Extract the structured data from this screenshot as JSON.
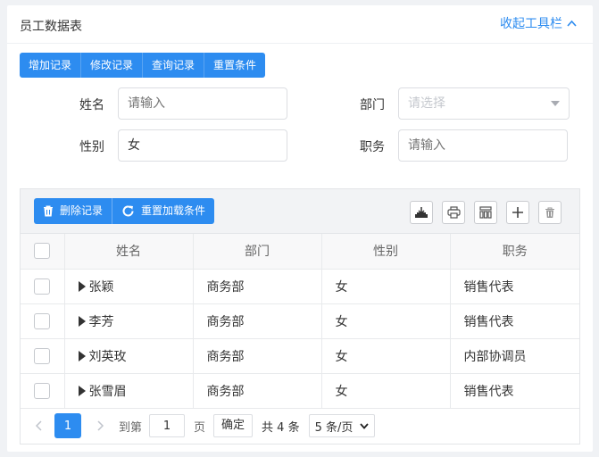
{
  "header": {
    "title": "员工数据表",
    "collapse_label": "收起工具栏"
  },
  "actions": [
    "增加记录",
    "修改记录",
    "查询记录",
    "重置条件"
  ],
  "form": {
    "name": {
      "label": "姓名",
      "placeholder": "请输入",
      "value": ""
    },
    "dept": {
      "label": "部门",
      "placeholder": "请选择",
      "value": ""
    },
    "gender": {
      "label": "性别",
      "value": "女"
    },
    "position": {
      "label": "职务",
      "placeholder": "请输入",
      "value": ""
    }
  },
  "toolbar": {
    "delete_label": "删除记录",
    "reload_label": "重置加载条件",
    "tools": [
      "import-icon",
      "print-icon",
      "columns-icon",
      "add-icon",
      "trash-icon"
    ]
  },
  "table": {
    "columns": [
      "姓名",
      "部门",
      "性别",
      "职务"
    ],
    "rows": [
      {
        "name": "张颖",
        "dept": "商务部",
        "gender": "女",
        "position": "销售代表"
      },
      {
        "name": "李芳",
        "dept": "商务部",
        "gender": "女",
        "position": "销售代表"
      },
      {
        "name": "刘英玫",
        "dept": "商务部",
        "gender": "女",
        "position": "内部协调员"
      },
      {
        "name": "张雪眉",
        "dept": "商务部",
        "gender": "女",
        "position": "销售代表"
      }
    ]
  },
  "pager": {
    "current_page": "1",
    "goto_label": "到第",
    "goto_value": "1",
    "page_unit": "页",
    "confirm_label": "确定",
    "total_text": "共 4 条",
    "page_size": "5 条/页"
  },
  "colors": {
    "primary": "#2d8cf0",
    "border": "#dcdee2"
  }
}
